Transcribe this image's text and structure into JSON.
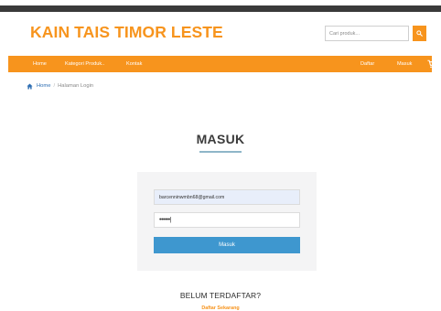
{
  "header": {
    "brand": "KAIN TAIS TIMOR LESTE",
    "search_placeholder": "Cari produk..."
  },
  "nav": {
    "home": "Home",
    "categories": "Kategori Produk..",
    "contact": "Kontak",
    "register": "Daftar",
    "login": "Masuk"
  },
  "breadcrumb": {
    "home": "Home",
    "current": "Halaman Login"
  },
  "login": {
    "title": "MASUK",
    "email_value": "barcenninwmbn68@gmail.com",
    "password_value": "••••••|",
    "submit_label": "Masuk"
  },
  "register": {
    "title": "BELUM TERDAFTAR?",
    "link": "Daftar Sekarang"
  },
  "colors": {
    "accent": "#f7941d",
    "button": "#3e97cf",
    "dark_strip": "#3a3a3a"
  }
}
